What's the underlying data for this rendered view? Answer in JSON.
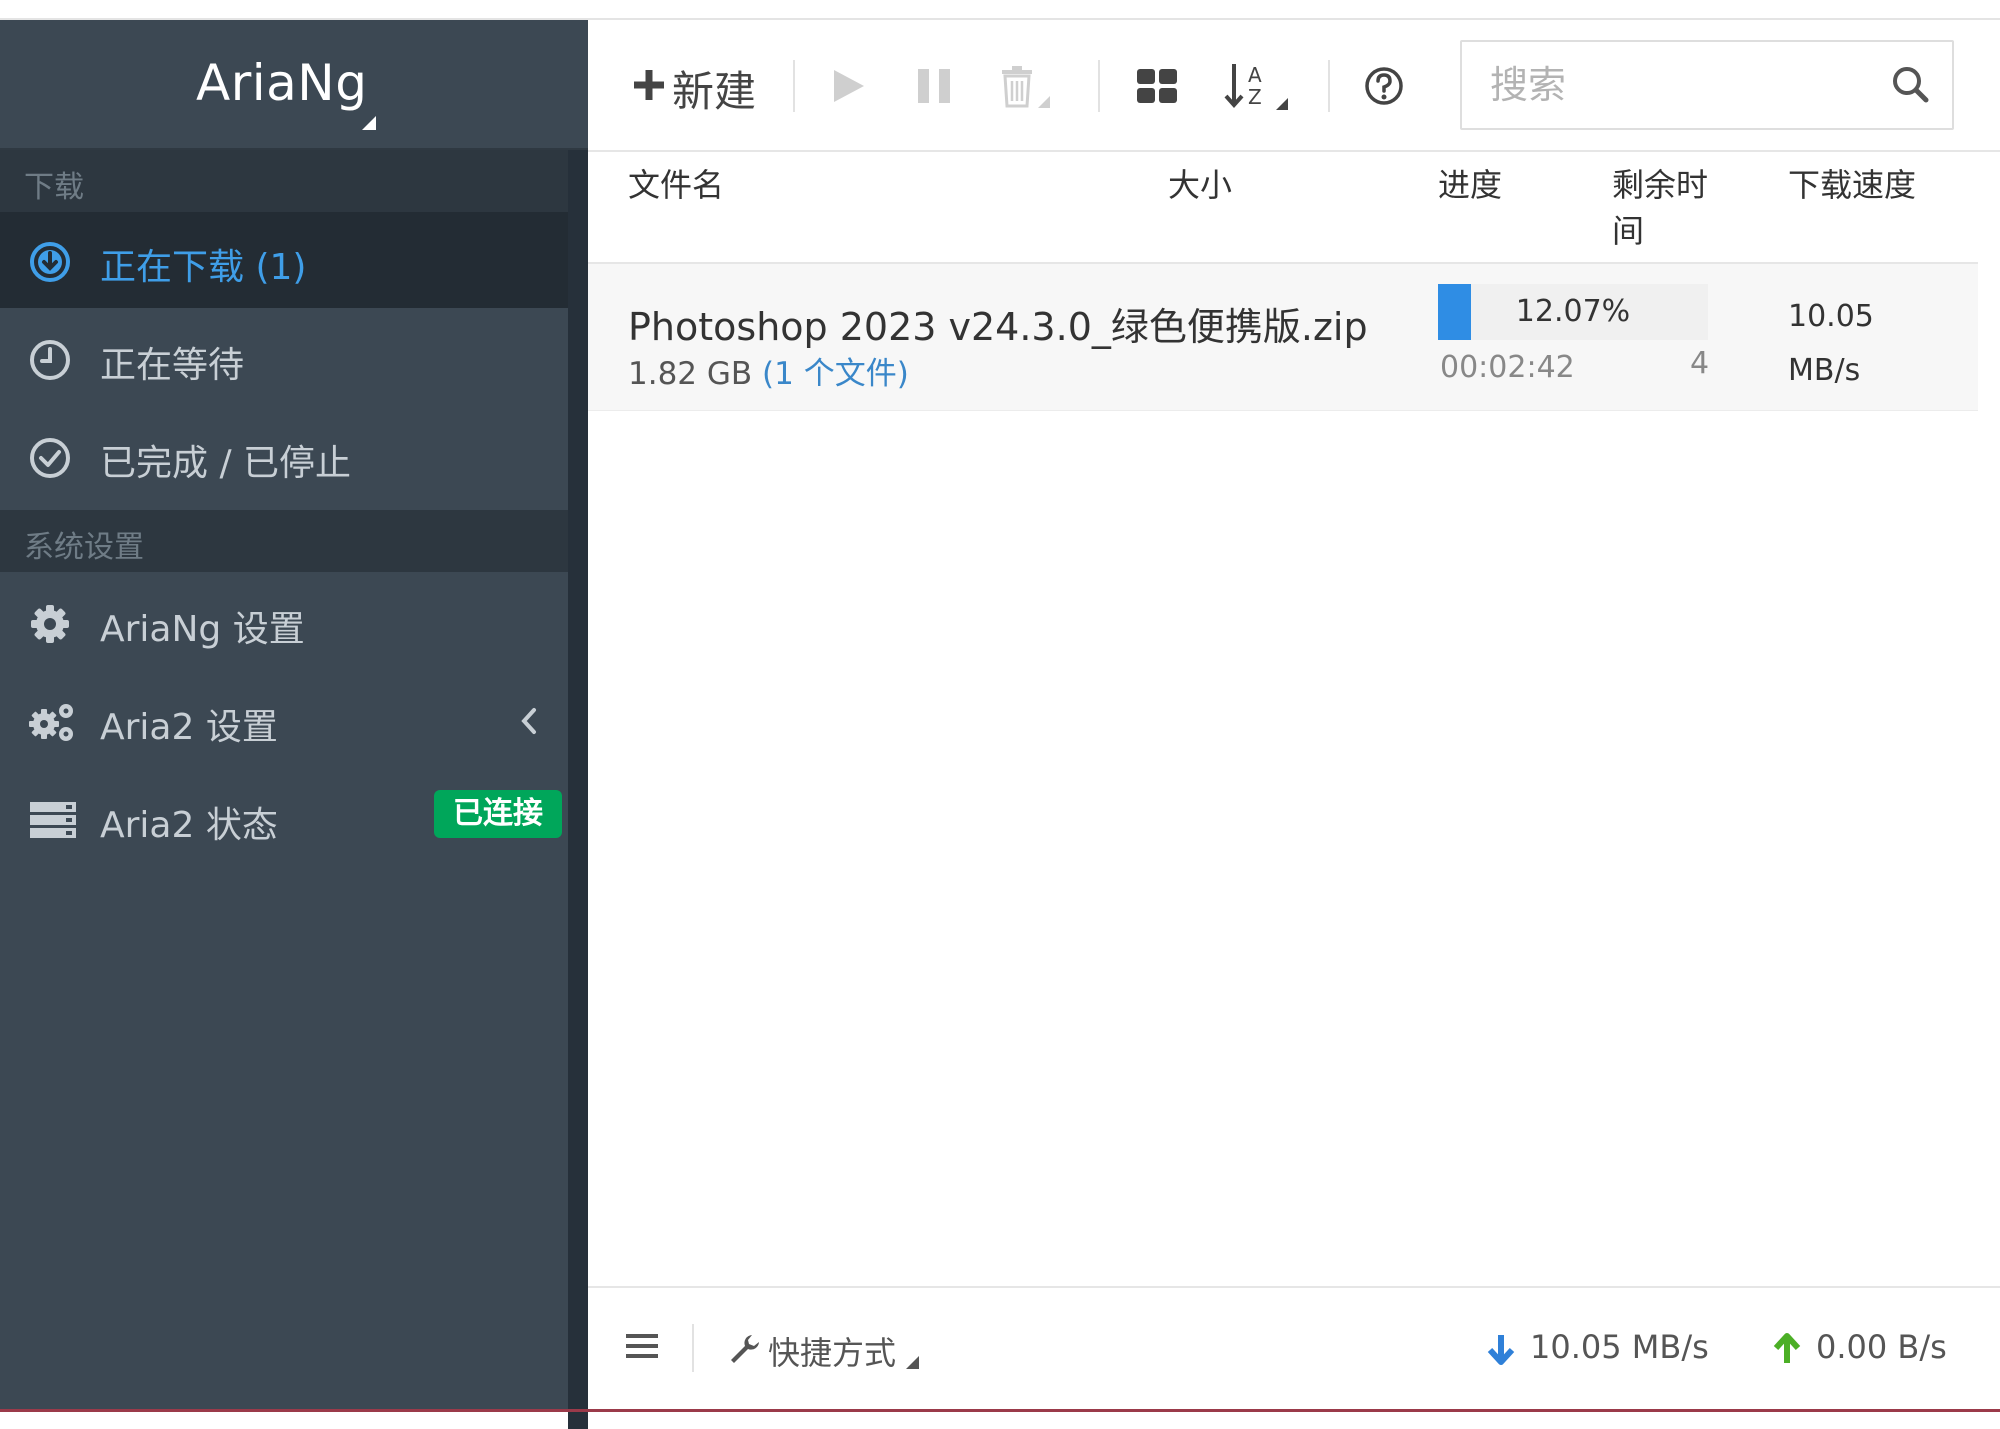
{
  "app": {
    "title": "AriaNg"
  },
  "sidebar": {
    "sections": [
      {
        "header": "下载",
        "items": [
          {
            "label": "正在下载 (1)",
            "icon": "arrow-circle-down-icon",
            "active": true
          },
          {
            "label": "正在等待",
            "icon": "clock-icon"
          },
          {
            "label": "已完成 / 已停止",
            "icon": "check-circle-icon"
          }
        ]
      },
      {
        "header": "系统设置",
        "items": [
          {
            "label": "AriaNg 设置",
            "icon": "gear-icon"
          },
          {
            "label": "Aria2 设置",
            "icon": "gears-icon"
          },
          {
            "label": "Aria2 状态",
            "icon": "server-icon",
            "badge": "已连接"
          }
        ]
      }
    ]
  },
  "toolbar": {
    "new_label": "新建",
    "search_placeholder": "搜索"
  },
  "table": {
    "columns": [
      "文件名",
      "大小",
      "进度",
      "剩余时间",
      "下载速度"
    ],
    "rows": [
      {
        "name": "Photoshop 2023 v24.3.0_绿色便携版.zip",
        "size": "1.82 GB",
        "files": "(1 个文件)",
        "progress_text": "12.07%",
        "progress": 12.07,
        "remaining": "00:02:42",
        "connections": "4",
        "speed_value": "10.05",
        "speed_unit": "MB/s"
      }
    ]
  },
  "footer": {
    "shortcut_label": "快捷方式",
    "download_speed": "10.05 MB/s",
    "upload_speed": "0.00 B/s"
  },
  "colors": {
    "sidebar_bg": "#3c4853",
    "active_blue": "#3f9ee8",
    "progress_blue": "#2f8de4",
    "badge_green": "#00a65a",
    "download_arrow": "#2f80d8",
    "upload_arrow": "#4caf26"
  }
}
